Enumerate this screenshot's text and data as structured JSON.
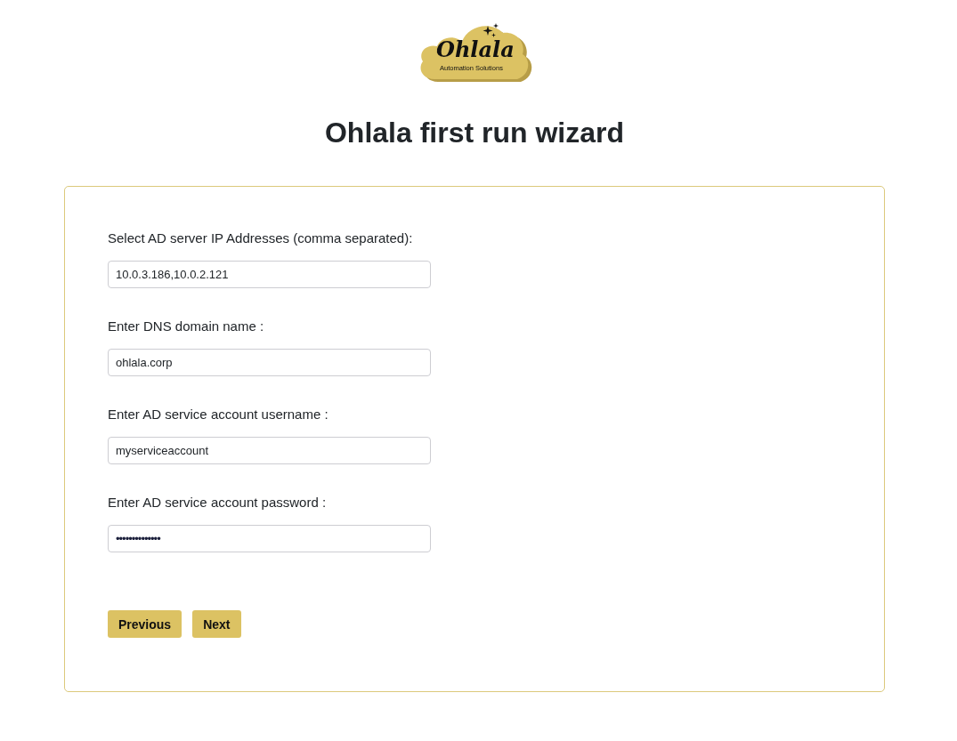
{
  "logo": {
    "name": "Ohlala",
    "tagline": "Automation Solutions"
  },
  "title": "Ohlala first run wizard",
  "fields": [
    {
      "kind": "text",
      "label": "Select AD server IP Addresses (comma separated):",
      "value": "10.0.3.186,10.0.2.121"
    },
    {
      "kind": "text",
      "label": "Enter DNS domain name :",
      "value": "ohlala.corp"
    },
    {
      "kind": "text",
      "label": "Enter AD service account username :",
      "value": "myserviceaccount"
    },
    {
      "kind": "password",
      "label": "Enter AD service account password :",
      "value": "••••••••••••••"
    }
  ],
  "buttons": [
    {
      "label": "Previous"
    },
    {
      "label": "Next"
    }
  ]
}
